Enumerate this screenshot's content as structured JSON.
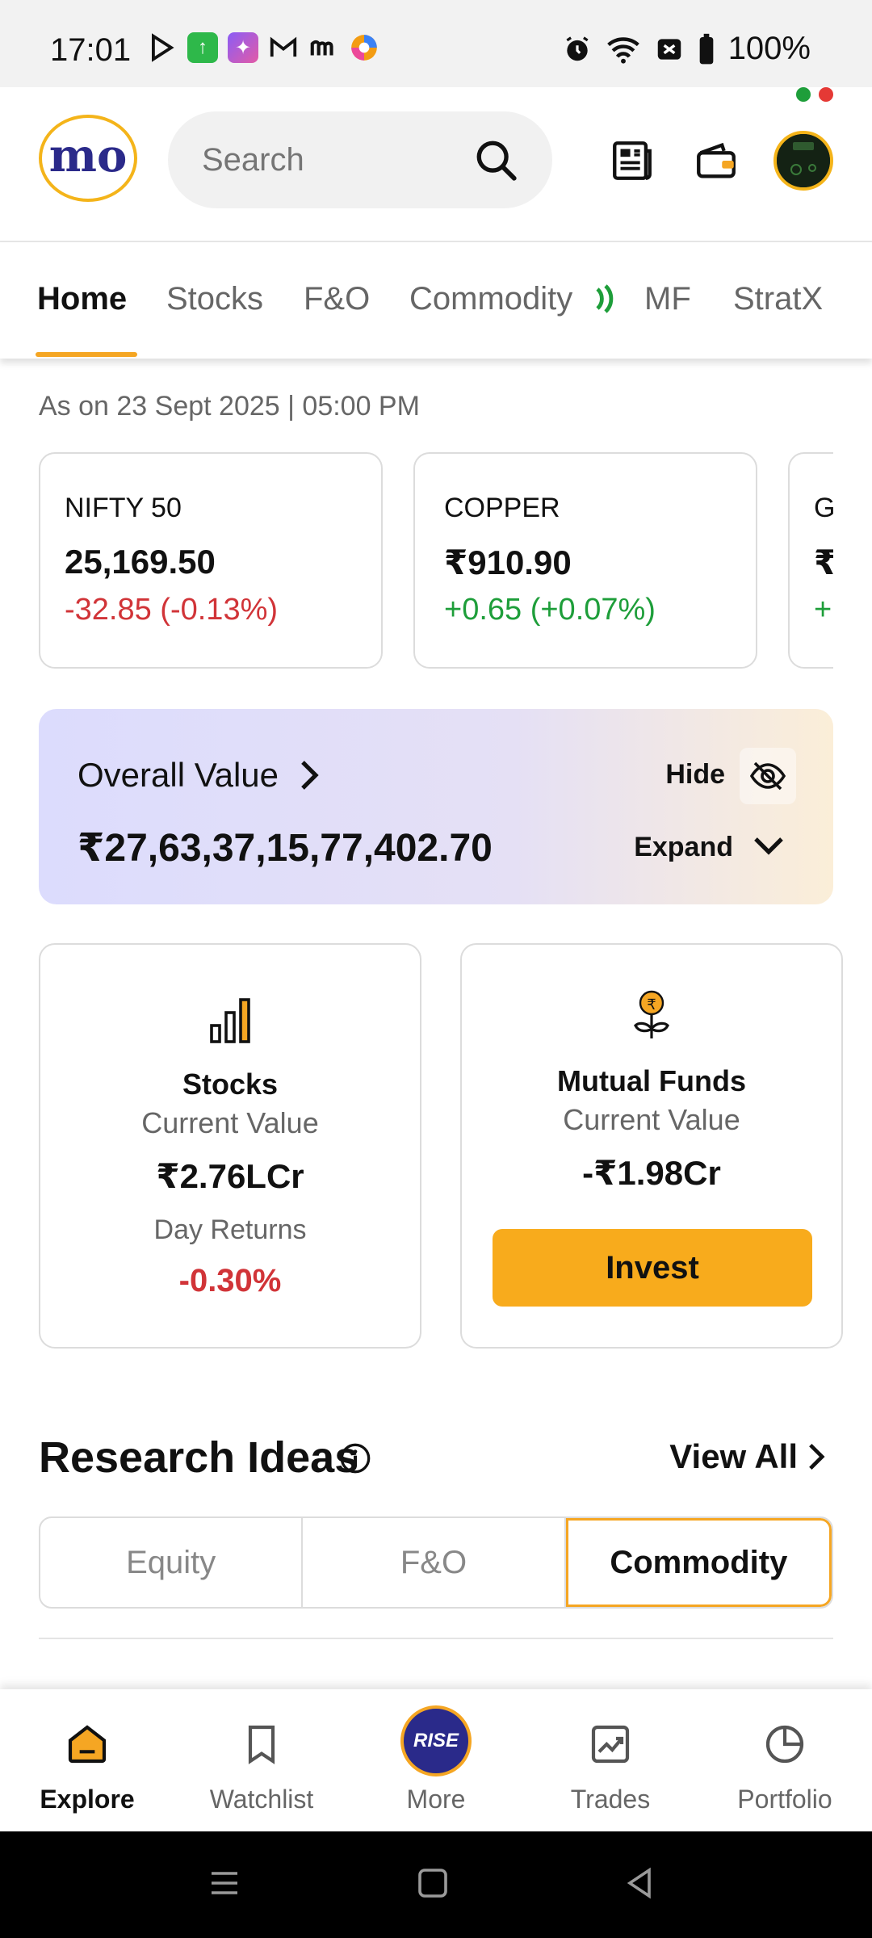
{
  "status_bar": {
    "time": "17:01",
    "battery": "100%"
  },
  "header": {
    "logo_text": "mo",
    "search_placeholder": "Search"
  },
  "tabs": [
    "Home",
    "Stocks",
    "F&O",
    "Commodity",
    "MF",
    "StratX"
  ],
  "as_on": "As on 23 Sept 2025 | 05:00 PM",
  "tickers": [
    {
      "name": "NIFTY 50",
      "price": "25,169.50",
      "change": "-32.85 (-0.13%)",
      "direction": "down"
    },
    {
      "name": "COPPER",
      "price": "₹910.90",
      "change": "+0.65 (+0.07%)",
      "direction": "up"
    },
    {
      "name": "G",
      "price": "₹",
      "change": "+",
      "direction": "up"
    }
  ],
  "overall": {
    "label": "Overall Value",
    "value": "₹27,63,37,15,77,402.70",
    "hide_label": "Hide",
    "expand_label": "Expand"
  },
  "stocks_card": {
    "title": "Stocks",
    "current_label": "Current Value",
    "current_value": "₹2.76LCr",
    "day_returns_label": "Day Returns",
    "day_returns_value": "-0.30%"
  },
  "mf_card": {
    "title": "Mutual Funds",
    "current_label": "Current Value",
    "current_value": "-₹1.98Cr",
    "invest_label": "Invest"
  },
  "research": {
    "title": "Research Ideas",
    "view_all": "View All",
    "segments": [
      "Equity",
      "F&O",
      "Commodity"
    ],
    "active_segment": "Commodity"
  },
  "bottom_nav": [
    {
      "label": "Explore",
      "active": true
    },
    {
      "label": "Watchlist",
      "active": false
    },
    {
      "label": "More",
      "active": false,
      "badge": "RISE"
    },
    {
      "label": "Trades",
      "active": false
    },
    {
      "label": "Portfolio",
      "active": false
    }
  ],
  "colors": {
    "accent": "#f5a623",
    "negative": "#d13438",
    "positive": "#1e9e3a",
    "brand": "#2b2a8a"
  }
}
